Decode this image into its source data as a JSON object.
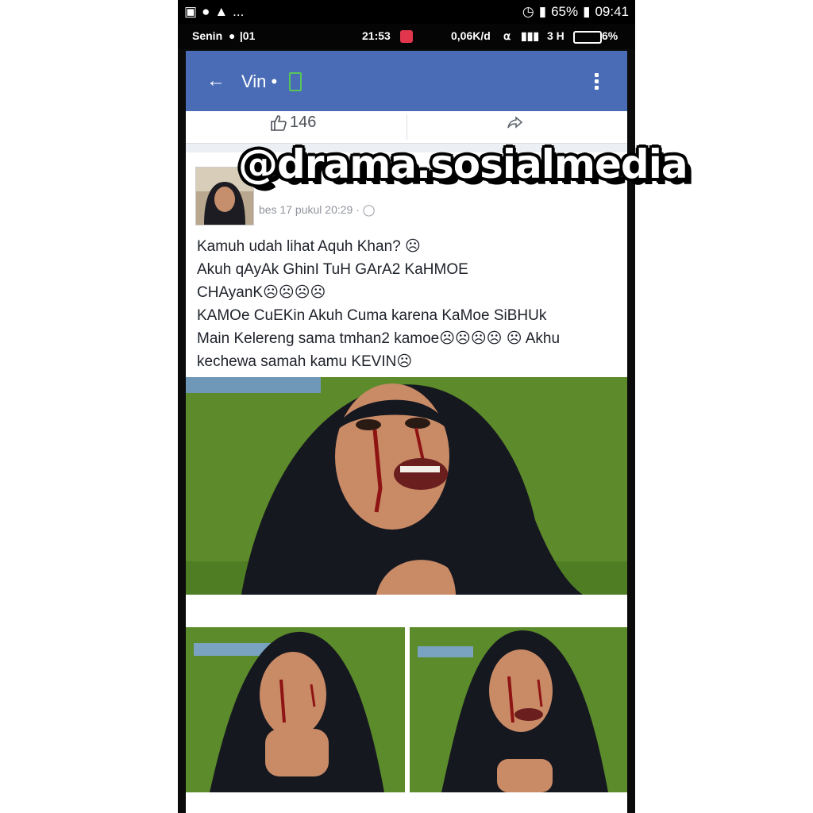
{
  "outer_status": {
    "battery": "65%",
    "time": "09:41",
    "left_icons": [
      "image-icon",
      "messenger-icon",
      "warning-icon"
    ],
    "more": "..."
  },
  "inner_status": {
    "day": "Senin",
    "carrier": " |01",
    "time": "21:53",
    "speed": "0,06K/d",
    "network": "3 H",
    "battery": "6%"
  },
  "appbar": {
    "back_icon": "back-arrow-icon",
    "title": "Vin •",
    "menu_icon": "more-vertical-icon"
  },
  "actions": {
    "like_count": "146",
    "like_icon": "thumbs-up-icon",
    "share_icon": "share-icon"
  },
  "post": {
    "timestamp": "bes 17 pukul 20:29 ·",
    "lines": [
      "Kamuh udah lihat Aquh Khan? ☹",
      "Akuh qAyAk GhinI TuH GArA2 KaHMOE",
      "CHAyanK☹☹☹☹",
      "KAMOe CuEKin Akuh Cuma karena KaMoe SiBHUk",
      "Main Kelereng sama tmhan2 kamoe☹☹☹☹ ☹ Akhu",
      "kechewa samah kamu KEVIN☹"
    ]
  },
  "watermark": "@drama.sosialmedia",
  "colors": {
    "appbar": "#4a6cb6",
    "wall": "#5d8a2a",
    "hijab": "#161820",
    "skin": "#c98a66"
  }
}
